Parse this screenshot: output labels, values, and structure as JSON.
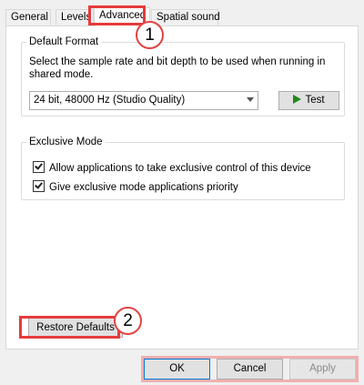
{
  "tabs": [
    {
      "label": "General"
    },
    {
      "label": "Levels"
    },
    {
      "label": "Advanced"
    },
    {
      "label": "Spatial sound"
    }
  ],
  "default_format": {
    "title": "Default Format",
    "description": "Select the sample rate and bit depth to be used when running in shared mode.",
    "selected_format": "24 bit, 48000 Hz (Studio Quality)",
    "test_label": "Test"
  },
  "exclusive_mode": {
    "title": "Exclusive Mode",
    "options": [
      {
        "label": "Allow applications to take exclusive control of this device",
        "checked": true
      },
      {
        "label": "Give exclusive mode applications priority",
        "checked": true
      }
    ]
  },
  "restore_defaults_label": "Restore Defaults",
  "callouts": [
    "1",
    "2"
  ],
  "buttons": {
    "ok": "OK",
    "cancel": "Cancel",
    "apply": "Apply"
  },
  "colors": {
    "highlight": "#e63b3b",
    "play_icon": "#1e8b1e",
    "ok_border": "#0078d7"
  },
  "icons": {
    "play": "play-icon",
    "dropdown": "chevron-down-icon",
    "check": "checkmark-icon"
  }
}
